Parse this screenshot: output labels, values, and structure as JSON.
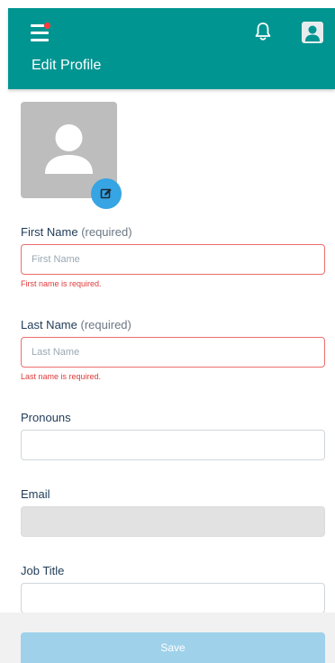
{
  "header": {
    "title": "Edit Profile",
    "menu_icon": "menu-icon",
    "notification_icon": "bell-icon",
    "profile_icon": "user-icon",
    "brand_color": "#009591"
  },
  "form": {
    "first_name": {
      "label": "First Name",
      "required_note": "(required)",
      "placeholder": "First Name",
      "value": "",
      "error": "First name is required."
    },
    "last_name": {
      "label": "Last Name",
      "required_note": "(required)",
      "placeholder": "Last Name",
      "value": "",
      "error": "Last name is required."
    },
    "pronouns": {
      "label": "Pronouns",
      "value": ""
    },
    "email": {
      "label": "Email",
      "value": ""
    },
    "job_title": {
      "label": "Job Title",
      "value": ""
    }
  },
  "footer": {
    "save_label": "Save"
  },
  "colors": {
    "error": "#e03a3a",
    "accent": "#37a4e3",
    "save_disabled": "#9fd1ea"
  }
}
